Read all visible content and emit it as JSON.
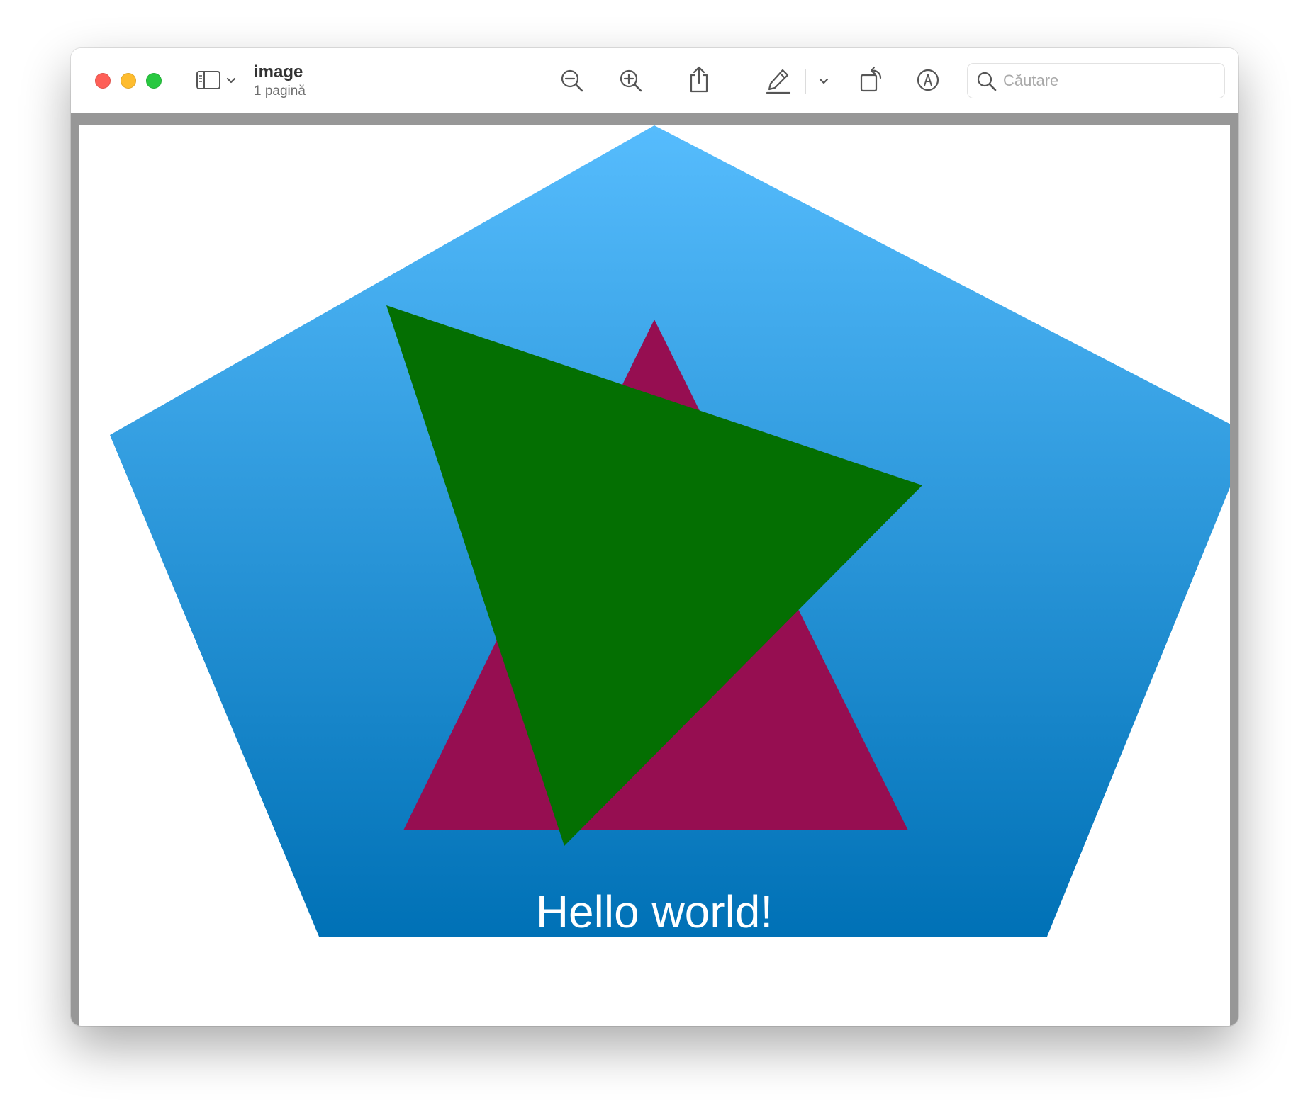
{
  "window": {
    "title": "image",
    "subtitle": "1 pagină"
  },
  "toolbar": {
    "icons": [
      "sidebar-icon",
      "chevron-down-icon",
      "zoom-out-icon",
      "zoom-in-icon",
      "share-icon",
      "markup-pen-icon",
      "chevron-down-icon",
      "rotate-icon",
      "annotate-icon"
    ],
    "search_placeholder": "Căutare"
  },
  "document": {
    "text": "Hello world!",
    "colors": {
      "pentagon_top": "#56bcfd",
      "pentagon_bottom": "#0071b6",
      "triangle_magenta": "#960e51",
      "triangle_green": "#046f02",
      "text": "#ffffff"
    }
  }
}
